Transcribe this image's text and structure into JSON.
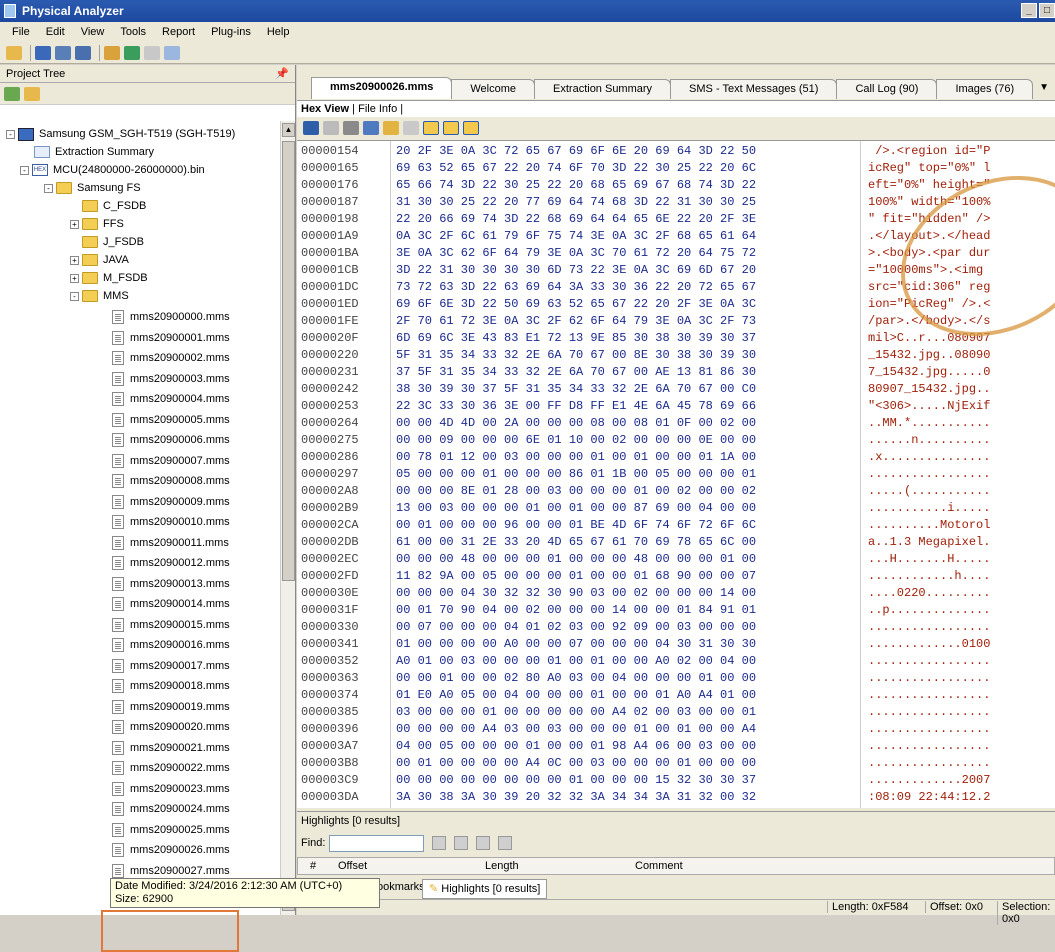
{
  "window": {
    "title": "Physical Analyzer"
  },
  "menu": [
    "File",
    "Edit",
    "View",
    "Tools",
    "Report",
    "Plug-ins",
    "Help"
  ],
  "project_tree": {
    "header": "Project Tree",
    "pin_icon": "pin-icon",
    "device": "Samsung GSM_SGH-T519 (SGH-T519)",
    "extraction_summary": "Extraction Summary",
    "bin": "MCU(24800000-26000000).bin",
    "fs": "Samsung FS",
    "folders": [
      "C_FSDB",
      "FFS",
      "J_FSDB",
      "JAVA",
      "M_FSDB",
      "MMS"
    ],
    "files": [
      "mms20900000.mms",
      "mms20900001.mms",
      "mms20900002.mms",
      "mms20900003.mms",
      "mms20900004.mms",
      "mms20900005.mms",
      "mms20900006.mms",
      "mms20900007.mms",
      "mms20900008.mms",
      "mms20900009.mms",
      "mms20900010.mms",
      "mms20900011.mms",
      "mms20900012.mms",
      "mms20900013.mms",
      "mms20900014.mms",
      "mms20900015.mms",
      "mms20900016.mms",
      "mms20900017.mms",
      "mms20900018.mms",
      "mms20900019.mms",
      "mms20900020.mms",
      "mms20900021.mms",
      "mms20900022.mms",
      "mms20900023.mms",
      "mms20900024.mms",
      "mms20900025.mms",
      "mms20900026.mms",
      "mms20900027.mms"
    ]
  },
  "tooltip": {
    "line1": "Date Modified: 3/24/2016 2:12:30 AM (UTC+0)",
    "line2": "Size: 62900"
  },
  "tabs": [
    "mms20900026.mms",
    "Welcome",
    "Extraction Summary",
    "SMS - Text Messages (51)",
    "Call Log (90)",
    "Images (76)"
  ],
  "subtabs": {
    "hex": "Hex View",
    "info": "File Info"
  },
  "hex_rows": [
    [
      "00000154",
      "20 2F 3E 0A 3C 72 65 67 69 6F 6E 20 69 64 3D 22 50",
      " />.<region id=\"P"
    ],
    [
      "00000165",
      "69 63 52 65 67 22 20 74 6F 70 3D 22 30 25 22 20 6C",
      "icReg\" top=\"0%\" l"
    ],
    [
      "00000176",
      "65 66 74 3D 22 30 25 22 20 68 65 69 67 68 74 3D 22",
      "eft=\"0%\" height=\""
    ],
    [
      "00000187",
      "31 30 30 25 22 20 77 69 64 74 68 3D 22 31 30 30 25",
      "100%\" width=\"100%"
    ],
    [
      "00000198",
      "22 20 66 69 74 3D 22 68 69 64 64 65 6E 22 20 2F 3E",
      "\" fit=\"hidden\" />"
    ],
    [
      "000001A9",
      "0A 3C 2F 6C 61 79 6F 75 74 3E 0A 3C 2F 68 65 61 64",
      ".</layout>.</head"
    ],
    [
      "000001BA",
      "3E 0A 3C 62 6F 64 79 3E 0A 3C 70 61 72 20 64 75 72",
      ">.<body>.<par dur"
    ],
    [
      "000001CB",
      "3D 22 31 30 30 30 30 6D 73 22 3E 0A 3C 69 6D 67 20",
      "=\"10000ms\">.<img "
    ],
    [
      "000001DC",
      "73 72 63 3D 22 63 69 64 3A 33 30 36 22 20 72 65 67",
      "src=\"cid:306\" reg"
    ],
    [
      "000001ED",
      "69 6F 6E 3D 22 50 69 63 52 65 67 22 20 2F 3E 0A 3C",
      "ion=\"PicReg\" />.<"
    ],
    [
      "000001FE",
      "2F 70 61 72 3E 0A 3C 2F 62 6F 64 79 3E 0A 3C 2F 73",
      "/par>.</body>.</s"
    ],
    [
      "0000020F",
      "6D 69 6C 3E 43 83 E1 72 13 9E 85 30 38 30 39 30 37",
      "mil>C..r...080907"
    ],
    [
      "00000220",
      "5F 31 35 34 33 32 2E 6A 70 67 00 8E 30 38 30 39 30",
      "_15432.jpg..08090"
    ],
    [
      "00000231",
      "37 5F 31 35 34 33 32 2E 6A 70 67 00 AE 13 81 86 30",
      "7_15432.jpg.....0"
    ],
    [
      "00000242",
      "38 30 39 30 37 5F 31 35 34 33 32 2E 6A 70 67 00 C0",
      "80907_15432.jpg.."
    ],
    [
      "00000253",
      "22 3C 33 30 36 3E 00 FF D8 FF E1 4E 6A 45 78 69 66",
      "\"<306>.....NjExif"
    ],
    [
      "00000264",
      "00 00 4D 4D 00 2A 00 00 00 08 00 08 01 0F 00 02 00",
      "..MM.*..........."
    ],
    [
      "00000275",
      "00 00 09 00 00 00 6E 01 10 00 02 00 00 00 0E 00 00",
      "......n.........."
    ],
    [
      "00000286",
      "00 78 01 12 00 03 00 00 00 01 00 01 00 00 01 1A 00",
      ".x..............."
    ],
    [
      "00000297",
      "05 00 00 00 01 00 00 00 86 01 1B 00 05 00 00 00 01",
      "................."
    ],
    [
      "000002A8",
      "00 00 00 8E 01 28 00 03 00 00 00 01 00 02 00 00 02",
      ".....(..........."
    ],
    [
      "000002B9",
      "13 00 03 00 00 00 01 00 01 00 00 87 69 00 04 00 00",
      "...........i....."
    ],
    [
      "000002CA",
      "00 01 00 00 00 96 00 00 01 BE 4D 6F 74 6F 72 6F 6C",
      "..........Motorol"
    ],
    [
      "000002DB",
      "61 00 00 31 2E 33 20 4D 65 67 61 70 69 78 65 6C 00",
      "a..1.3 Megapixel."
    ],
    [
      "000002EC",
      "00 00 00 48 00 00 00 01 00 00 00 48 00 00 00 01 00",
      "...H.......H....."
    ],
    [
      "000002FD",
      "11 82 9A 00 05 00 00 00 01 00 00 01 68 90 00 00 07",
      "............h...."
    ],
    [
      "0000030E",
      "00 00 00 04 30 32 32 30 90 03 00 02 00 00 00 14 00",
      "....0220........."
    ],
    [
      "0000031F",
      "00 01 70 90 04 00 02 00 00 00 14 00 00 01 84 91 01",
      "..p.............."
    ],
    [
      "00000330",
      "00 07 00 00 00 04 01 02 03 00 92 09 00 03 00 00 00",
      "................."
    ],
    [
      "00000341",
      "01 00 00 00 00 A0 00 00 07 00 00 00 04 30 31 30 30",
      ".............0100"
    ],
    [
      "00000352",
      "A0 01 00 03 00 00 00 01 00 01 00 00 A0 02 00 04 00",
      "................."
    ],
    [
      "00000363",
      "00 00 01 00 00 02 80 A0 03 00 04 00 00 00 01 00 00",
      "................."
    ],
    [
      "00000374",
      "01 E0 A0 05 00 04 00 00 00 01 00 00 01 A0 A4 01 00",
      "................."
    ],
    [
      "00000385",
      "03 00 00 00 01 00 00 00 00 00 A4 02 00 03 00 00 01",
      "................."
    ],
    [
      "00000396",
      "00 00 00 00 A4 03 00 03 00 00 00 01 00 01 00 00 A4",
      "................."
    ],
    [
      "000003A7",
      "04 00 05 00 00 00 01 00 00 01 98 A4 06 00 03 00 00",
      "................."
    ],
    [
      "000003B8",
      "00 01 00 00 00 00 A4 0C 00 03 00 00 00 01 00 00 00",
      "................."
    ],
    [
      "000003C9",
      "00 00 00 00 00 00 00 00 01 00 00 00 15 32 30 30 37",
      ".............2007"
    ],
    [
      "000003DA",
      "3A 30 38 3A 30 39 20 32 32 3A 34 34 3A 31 32 00 32",
      ":08:09 22:44:12.2"
    ]
  ],
  "highlights": {
    "title": "Highlights [0 results]",
    "find_label": "Find:"
  },
  "grid": {
    "cols": [
      "#",
      "Offset",
      "Length",
      "Comment"
    ]
  },
  "bottom_tabs": {
    "bookmarks": "ookmarks",
    "highlights": "Highlights [0 results]"
  },
  "status": {
    "length": "Length: 0xF584",
    "offset": "Offset: 0x0",
    "selection": "Selection: 0x0"
  }
}
